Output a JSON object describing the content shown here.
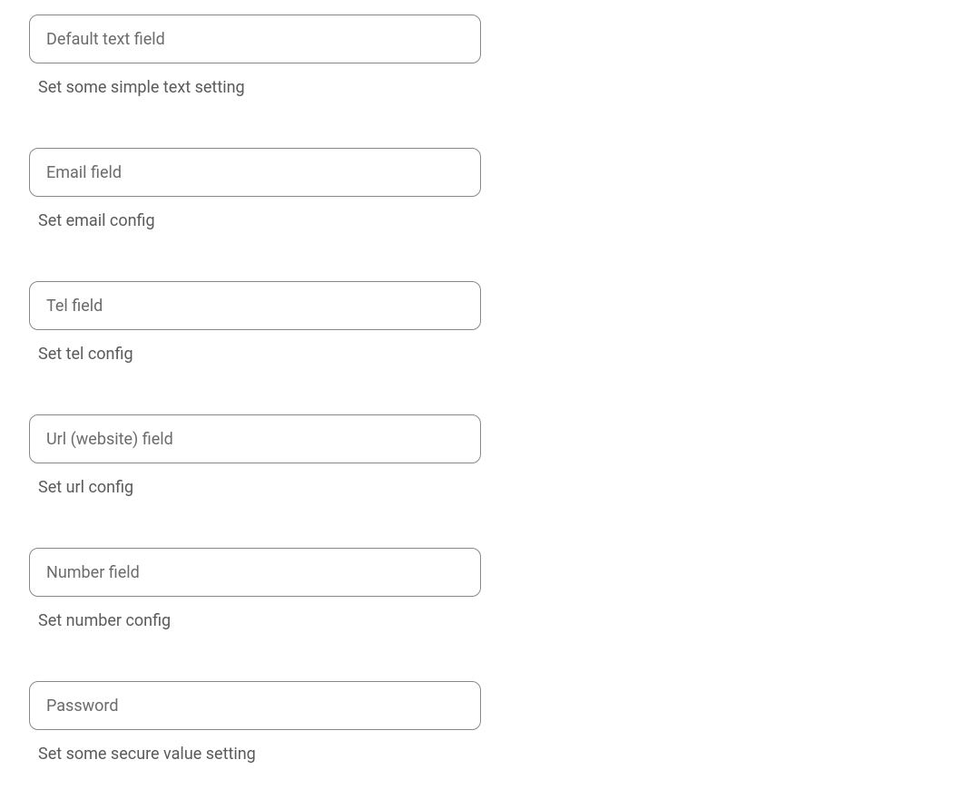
{
  "fields": [
    {
      "placeholder": "Default text field",
      "helper": "Set some simple text setting",
      "type": "text"
    },
    {
      "placeholder": "Email field",
      "helper": "Set email config",
      "type": "email"
    },
    {
      "placeholder": "Tel field",
      "helper": "Set tel config",
      "type": "tel"
    },
    {
      "placeholder": "Url (website) field",
      "helper": "Set url config",
      "type": "url"
    },
    {
      "placeholder": "Number field",
      "helper": "Set number config",
      "type": "number"
    },
    {
      "placeholder": "Password",
      "helper": "Set some secure value setting",
      "type": "password"
    }
  ]
}
